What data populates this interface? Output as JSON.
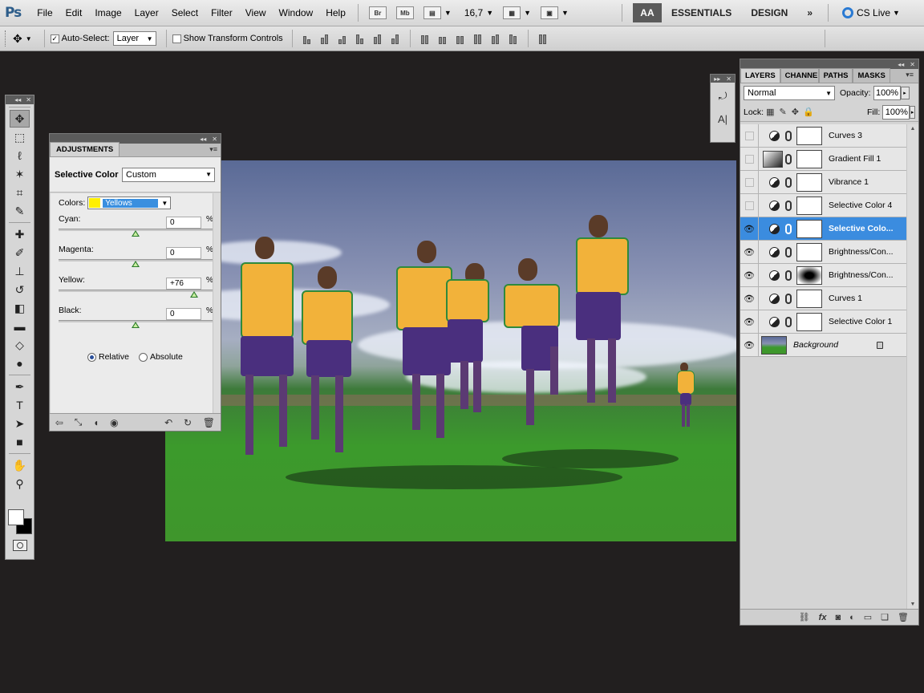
{
  "app": {
    "logo": "Ps"
  },
  "menu": [
    "File",
    "Edit",
    "Image",
    "Layer",
    "Select",
    "Filter",
    "View",
    "Window",
    "Help"
  ],
  "menubar": {
    "bridge": "Br",
    "minibridge": "Mb",
    "zoom": "16,7",
    "workspace_aa": "AA",
    "workspaces": [
      "ESSENTIALS",
      "DESIGN"
    ],
    "more": "»",
    "cs_live": "CS Live"
  },
  "options": {
    "auto_select_label": "Auto-Select:",
    "auto_select_value": "Layer",
    "show_transform_label": "Show Transform Controls"
  },
  "adjustments": {
    "tab": "ADJUSTMENTS",
    "title": "Selective Color",
    "preset": "Custom",
    "colors_label": "Colors:",
    "colors_value": "Yellows",
    "sliders": [
      {
        "label": "Cyan:",
        "value": "0",
        "unit": "%",
        "pos": 0.5
      },
      {
        "label": "Magenta:",
        "value": "0",
        "unit": "%",
        "pos": 0.5
      },
      {
        "label": "Yellow:",
        "value": "+76",
        "unit": "%",
        "pos": 0.88
      },
      {
        "label": "Black:",
        "value": "0",
        "unit": "%",
        "pos": 0.5
      }
    ],
    "method_relative": "Relative",
    "method_absolute": "Absolute"
  },
  "layers_panel": {
    "tabs": [
      "LAYERS",
      "CHANNE",
      "PATHS",
      "MASKS"
    ],
    "blend_mode": "Normal",
    "opacity_label": "Opacity:",
    "opacity": "100%",
    "lock_label": "Lock:",
    "fill_label": "Fill:",
    "fill": "100%",
    "layers": [
      {
        "name": "Curves 3",
        "visible": false,
        "kind": "adj"
      },
      {
        "name": "Gradient Fill 1",
        "visible": false,
        "kind": "grad"
      },
      {
        "name": "Vibrance 1",
        "visible": false,
        "kind": "adj"
      },
      {
        "name": "Selective Color 4",
        "visible": false,
        "kind": "adj"
      },
      {
        "name": "Selective Colo...",
        "visible": true,
        "kind": "adj",
        "selected": true
      },
      {
        "name": "Brightness/Con...",
        "visible": true,
        "kind": "adj"
      },
      {
        "name": "Brightness/Con...",
        "visible": true,
        "kind": "adj",
        "radial": true
      },
      {
        "name": "Curves 1",
        "visible": true,
        "kind": "adj"
      },
      {
        "name": "Selective Color 1",
        "visible": true,
        "kind": "adj"
      }
    ],
    "background_layer": "Background"
  },
  "colors": {
    "selection": "#3b8cdf",
    "yellow_swatch": "#ffef00"
  }
}
